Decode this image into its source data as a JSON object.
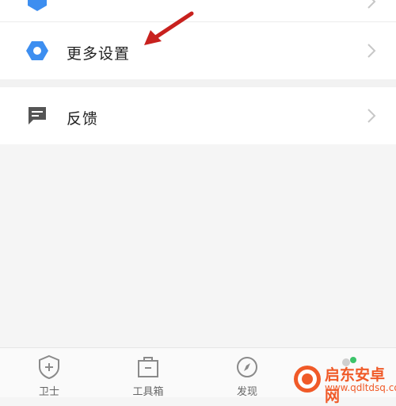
{
  "settings": {
    "top_item_label": "",
    "more_settings_label": "更多设置",
    "feedback_label": "反馈"
  },
  "tabbar": {
    "tabs": [
      {
        "label": "卫士",
        "icon": "shield-plus-icon"
      },
      {
        "label": "工具箱",
        "icon": "toolbox-icon"
      },
      {
        "label": "发现",
        "icon": "compass-icon"
      }
    ]
  },
  "watermark": {
    "title": "启东安卓网",
    "url": "www.qdltdsq.com"
  },
  "colors": {
    "hexagon_blue": "#3d8ef0",
    "arrow_red": "#c8211e",
    "icon_gray": "#555555",
    "watermark_orange": "#f05a28"
  }
}
